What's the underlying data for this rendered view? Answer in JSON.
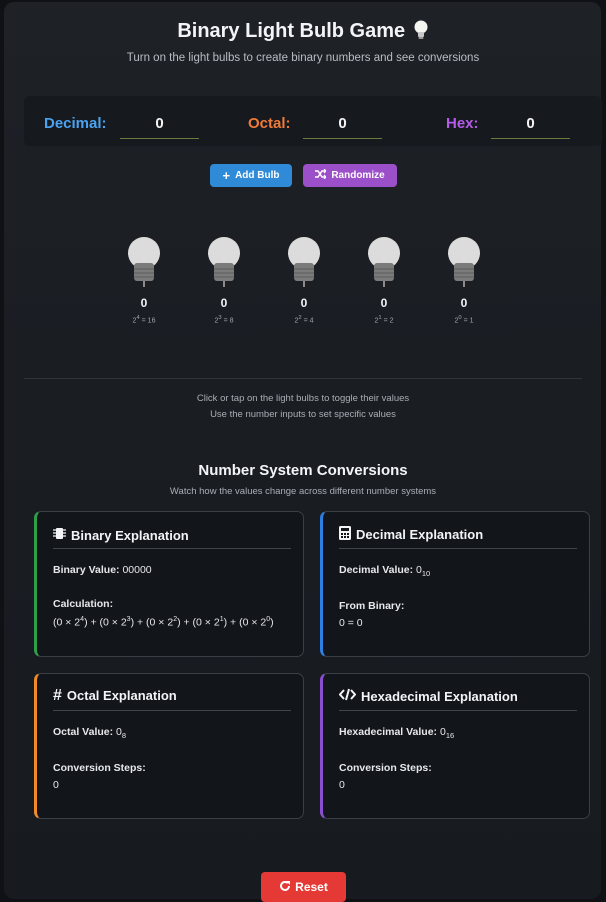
{
  "header": {
    "title": "Binary Light Bulb Game",
    "subtitle": "Turn on the light bulbs to create binary numbers and see conversions"
  },
  "converters": {
    "decimal": {
      "label": "Decimal:",
      "value": "0",
      "color": "#4aa3f0"
    },
    "octal": {
      "label": "Octal:",
      "value": "0",
      "color": "#f07a3a"
    },
    "hex": {
      "label": "Hex:",
      "value": "0",
      "color": "#b45ce8"
    }
  },
  "buttons": {
    "add_bulb": "Add Bulb",
    "randomize": "Randomize",
    "reset": "Reset"
  },
  "bulbs": [
    {
      "value": "0",
      "power_base": "2",
      "power_exp": "4",
      "power_result": "= 16"
    },
    {
      "value": "0",
      "power_base": "2",
      "power_exp": "3",
      "power_result": "= 8"
    },
    {
      "value": "0",
      "power_base": "2",
      "power_exp": "2",
      "power_result": "= 4"
    },
    {
      "value": "0",
      "power_base": "2",
      "power_exp": "1",
      "power_result": "= 2"
    },
    {
      "value": "0",
      "power_base": "2",
      "power_exp": "0",
      "power_result": "= 1"
    }
  ],
  "hints": {
    "line1": "Click or tap on the light bulbs to toggle their values",
    "line2": "Use the number inputs to set specific values"
  },
  "conversions": {
    "title": "Number System Conversions",
    "subtitle": "Watch how the values change across different number systems",
    "binary": {
      "title": "Binary Explanation",
      "value_label": "Binary Value:",
      "value": "00000",
      "calc_label": "Calculation:",
      "accent": "#2e9e4a"
    },
    "decimal": {
      "title": "Decimal Explanation",
      "value_label": "Decimal Value:",
      "value": "0",
      "base": "10",
      "from_label": "From Binary:",
      "from_value": "0 = 0",
      "accent": "#2f7fe0"
    },
    "octal": {
      "title": "Octal Explanation",
      "value_label": "Octal Value:",
      "value": "0",
      "base": "8",
      "steps_label": "Conversion Steps:",
      "steps_value": "0",
      "accent": "#f08a2a"
    },
    "hex": {
      "title": "Hexadecimal Explanation",
      "value_label": "Hexadecimal Value:",
      "value": "0",
      "base": "16",
      "steps_label": "Conversion Steps:",
      "steps_value": "0",
      "accent": "#8a4fd0"
    }
  }
}
